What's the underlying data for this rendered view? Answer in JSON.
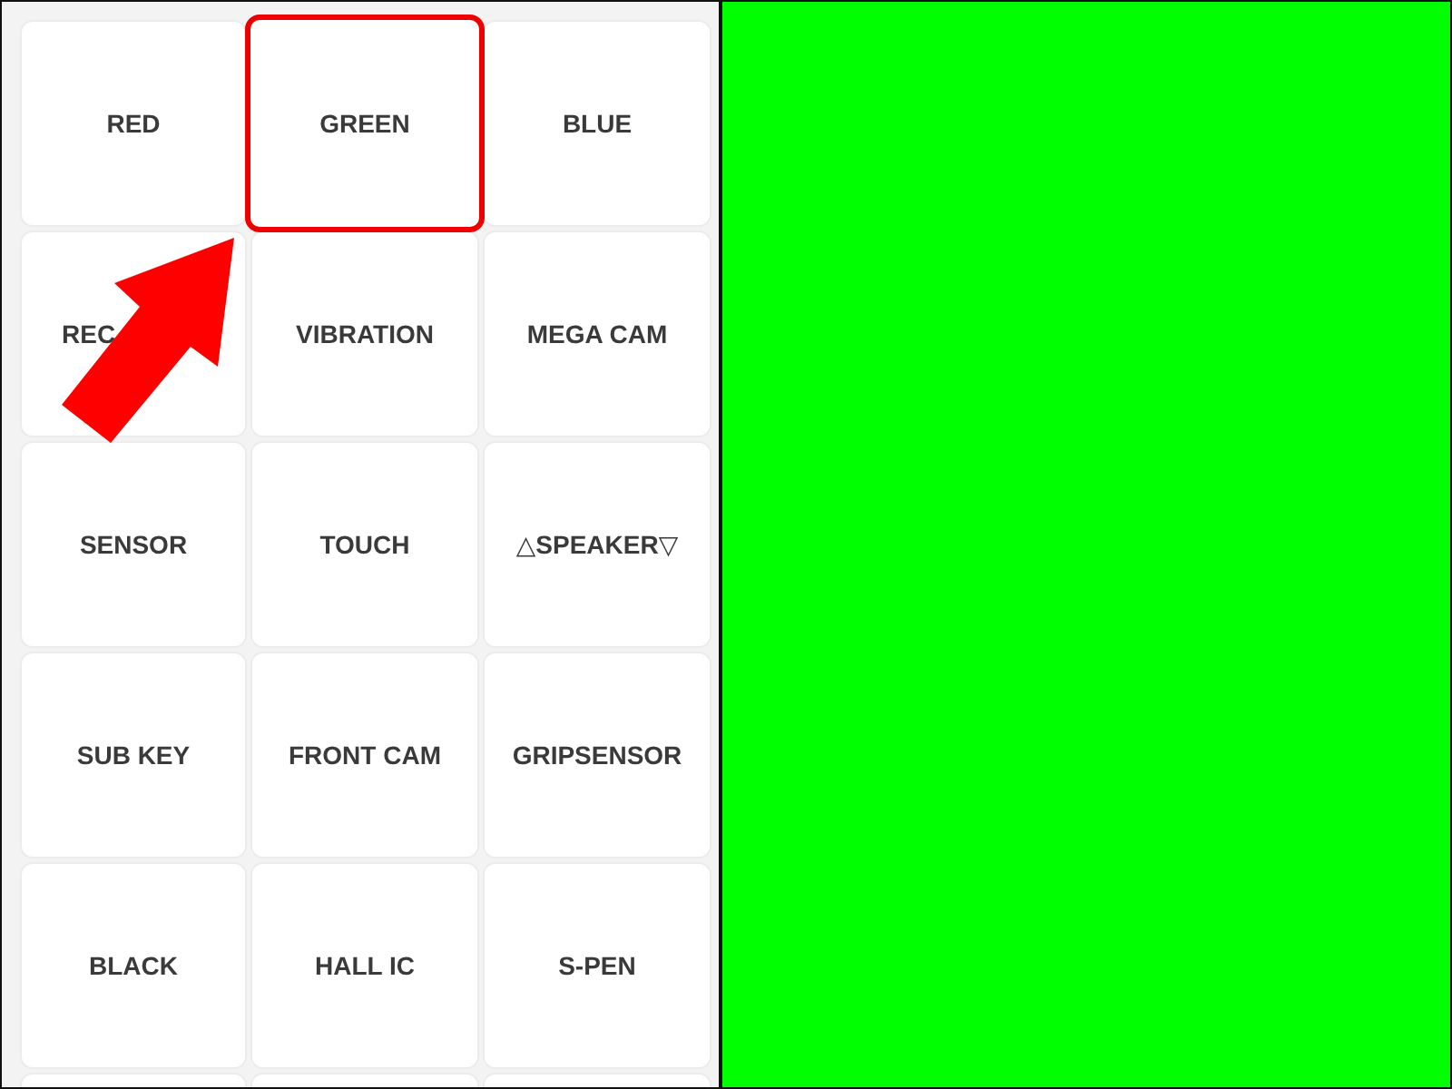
{
  "tiles": [
    {
      "label": "RED",
      "highlighted": false,
      "covered": false
    },
    {
      "label": "GREEN",
      "highlighted": true,
      "covered": false
    },
    {
      "label": "BLUE",
      "highlighted": false,
      "covered": false
    },
    {
      "label": "REC",
      "highlighted": false,
      "covered": true
    },
    {
      "label": "VIBRATION",
      "highlighted": false,
      "covered": false
    },
    {
      "label": "MEGA CAM",
      "highlighted": false,
      "covered": false
    },
    {
      "label": "SENSOR",
      "highlighted": false,
      "covered": false
    },
    {
      "label": "TOUCH",
      "highlighted": false,
      "covered": false
    },
    {
      "label": "△SPEAKER▽",
      "highlighted": false,
      "covered": false
    },
    {
      "label": "SUB KEY",
      "highlighted": false,
      "covered": false
    },
    {
      "label": "FRONT CAM",
      "highlighted": false,
      "covered": false
    },
    {
      "label": "GRIPSENSOR",
      "highlighted": false,
      "covered": false
    },
    {
      "label": "BLACK",
      "highlighted": false,
      "covered": false
    },
    {
      "label": "HALL IC",
      "highlighted": false,
      "covered": false
    },
    {
      "label": "S-PEN",
      "highlighted": false,
      "covered": false
    }
  ],
  "screen": {
    "color": "#00ff00"
  }
}
